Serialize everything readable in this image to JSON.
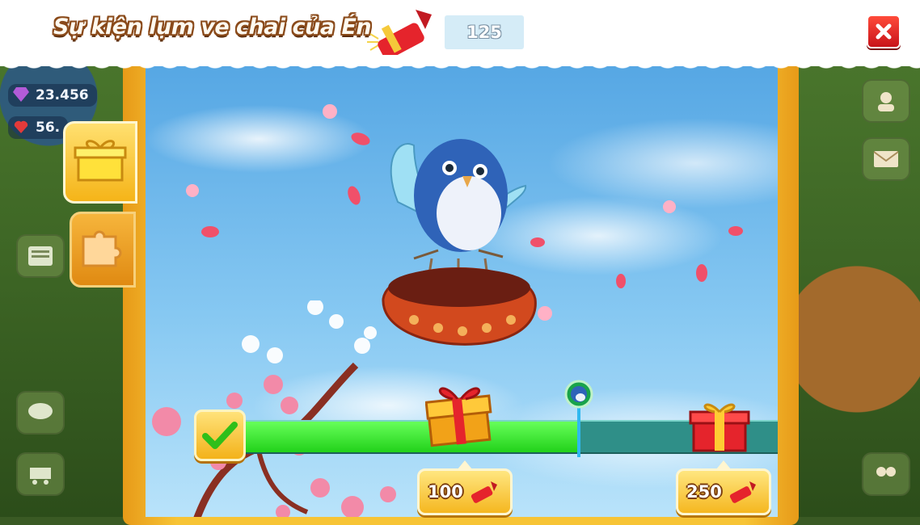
{
  "header": {
    "title": "Sự kiện lụm ve chai của Én",
    "firework_count": "125",
    "close_icon": "close-icon"
  },
  "background_hud": {
    "gems": "23.456",
    "hearts": "56."
  },
  "tabs": [
    {
      "name": "gift-tab",
      "icon": "gift-icon",
      "active": true
    },
    {
      "name": "puzzle-tab",
      "icon": "puzzle-icon",
      "active": false
    }
  ],
  "progress": {
    "current_fraction": 0.64,
    "milestones": [
      {
        "cost": "100",
        "icon": "firework-icon"
      },
      {
        "cost": "250",
        "icon": "firework-icon"
      }
    ]
  },
  "colors": {
    "progress_fill": "#2fe024",
    "track": "#2f8f88",
    "close_button": "#e0242a",
    "title_outline": "#8a4a1a",
    "panel_border": "#f7c436"
  }
}
